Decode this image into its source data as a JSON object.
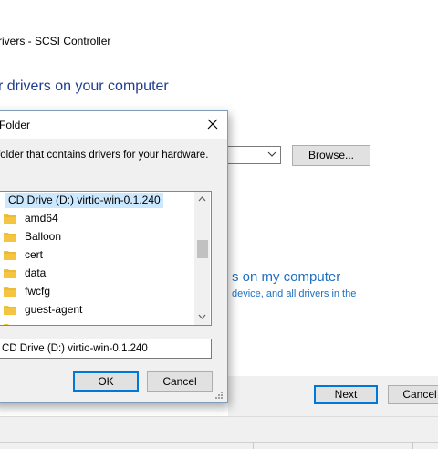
{
  "wizard": {
    "title": "rivers - SCSI Controller",
    "heading": "r drivers on your computer",
    "browse_label": "Browse...",
    "pick_link": "s on my computer",
    "pick_desc": "device, and all drivers in the",
    "next_label": "Next",
    "cancel_label": "Cancel"
  },
  "dialog": {
    "title": "Folder",
    "instruction": "folder that contains drivers for your hardware.",
    "tree_items": [
      {
        "label": "CD Drive (D:) virtio-win-0.1.240",
        "icon": "cd-drive-icon",
        "selected": true
      },
      {
        "label": "amd64",
        "icon": "folder-icon"
      },
      {
        "label": "Balloon",
        "icon": "folder-icon"
      },
      {
        "label": "cert",
        "icon": "folder-icon"
      },
      {
        "label": "data",
        "icon": "folder-icon"
      },
      {
        "label": "fwcfg",
        "icon": "folder-icon"
      },
      {
        "label": "guest-agent",
        "icon": "folder-icon"
      }
    ],
    "path_value": "CD Drive (D:) virtio-win-0.1.240",
    "ok_label": "OK",
    "cancel_label": "Cancel"
  },
  "colors": {
    "heading": "#1f3c8f",
    "link": "#1e6fc2",
    "selection": "#cce8ff",
    "focus_border": "#0078d7",
    "folder": "#f5c542"
  }
}
